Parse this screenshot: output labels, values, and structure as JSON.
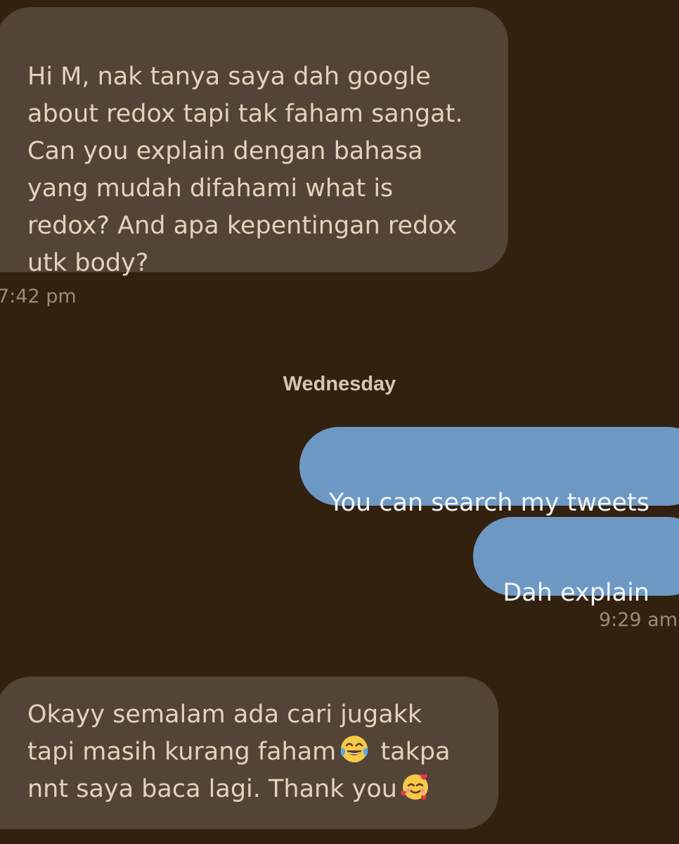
{
  "conversation": {
    "messages": [
      {
        "direction": "received",
        "text": "Hi M, nak tanya saya dah google\nabout redox tapi tak faham sangat.\nCan you explain dengan bahasa\nyang mudah difahami what is\nredox? And apa kepentingan redox\nutk body?"
      },
      {
        "direction": "sent",
        "text": "You can search my tweets"
      },
      {
        "direction": "sent",
        "text": "Dah explain"
      },
      {
        "direction": "received",
        "text_part1": "Okayy semalam ada cari jugakk\ntapi masih kurang faham",
        "emoji1": "face-with-tears-of-joy-icon",
        "text_part2": " takpa\nnnt saya baca lagi. Thank you",
        "emoji2": "smiling-face-with-hearts-icon"
      }
    ],
    "timestamps": {
      "first": "7:42 pm",
      "second": "9:29 am"
    },
    "day_separator": "Wednesday"
  },
  "colors": {
    "background": "#33210f",
    "received_bubble": "#524437",
    "sent_bubble": "#6d98c4",
    "text_light": "#e4d2bc",
    "timestamp": "#9a8b7a"
  }
}
